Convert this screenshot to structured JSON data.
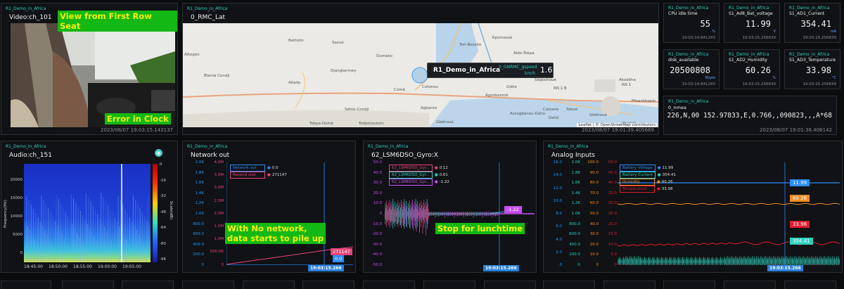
{
  "video": {
    "source": "R1_Demo_in_Africa",
    "title": "Video:ch_101",
    "label_top": "View from First Row Seat",
    "label_bottom": "Error in Clock",
    "timestamp": "2023/08/07 19:03:15.143137"
  },
  "map": {
    "source": "R1_Demo_in_Africa",
    "title": "0_RMC_Lat",
    "timestamp": "2023/08/07 19:01:39.405669",
    "attribution": "Leaflet | © OpenStreetMap contributors",
    "popup_name": "R1_Demo_in_Africa",
    "popup_field": "0_GNRMC_gspeed",
    "popup_unit": "km/h",
    "popup_value": "1.6",
    "road1": "RNIE 1",
    "road2": "RN 1",
    "places": [
      "Bathoto",
      "Sazué",
      "Oumako",
      "Tori-Bossito",
      "Attogon",
      "Djanglanmey",
      "Allada",
      "Blama Condji",
      "Séhio-Condji",
      "Cotonou",
      "Agbanto",
      "Agonkanmè",
      "Gbéhoué",
      "Ouidah",
      "Kpomassé",
      "Ségbohoué",
      "Todjonoukoin",
      "Aïdo-Tokpa",
      "Dahé",
      "Assogbénou-Daho",
      "Gléta",
      "Calvaire",
      "Gbèhoué",
      "Toboé",
      "Tokpa-Domè",
      "Akodéha",
      "Comè",
      "RN 1 B",
      "RN 1",
      "Misankbopin"
    ]
  },
  "metrics": [
    {
      "source": "R1_Demo_in_Africa",
      "title": "CPU idle time",
      "value": "55",
      "unit": "%",
      "ts": "19:03:14.841293"
    },
    {
      "source": "R1_Demo_in_Africa",
      "title": "S1_Ad8_Bat_voltage",
      "value": "11.99",
      "unit": "V",
      "ts": "19:03:15.256839"
    },
    {
      "source": "R1_Demo_in_Africa",
      "title": "S1_AD1_Current",
      "value": "354.41",
      "unit": "mA",
      "ts": "19:03:15.256839"
    },
    {
      "source": "R1_Demo_in_Africa",
      "title": "disk_available",
      "value": "20500808",
      "unit": "Kbyte",
      "ts": "19:03:14.841293"
    },
    {
      "source": "R1_Demo_in_Africa",
      "title": "S1_AD2_Humidity",
      "value": "60.26",
      "unit": "%",
      "ts": "19:03:15.256839"
    },
    {
      "source": "R1_Demo_in_Africa",
      "title": "S1_AD3_Temperature",
      "value": "33.98",
      "unit": "°C",
      "ts": "19:03:15.256839"
    }
  ],
  "nmea": {
    "source": "R1_Demo_in_Africa",
    "title": "0_nmea",
    "value": "226,N,00 152.97833,E,0.766,,090823,,,A*68",
    "timestamp": "2023/08/07 19:01:38.406142"
  },
  "audio": {
    "source": "R1_Demo_in_Africa",
    "title": "Audio:ch_151",
    "ylabel": "Frequency(Hz)",
    "cbar_label": "Scale(dB)",
    "yticks": [
      "20000",
      "15000",
      "10000",
      "5000",
      "0"
    ],
    "xticks": [
      "18:45:00",
      "18:50:00",
      "18:55:00",
      "19:00:00",
      "19:05:00"
    ],
    "cbar_ticks": [
      "0",
      "-16",
      "-32",
      "-48",
      "-64",
      "-80",
      "-96"
    ]
  },
  "network": {
    "source": "R1_Demo_in_Africa",
    "title": "Network out",
    "legend": [
      {
        "name": "Network out",
        "value": "0.0",
        "color": "#2a8cff"
      },
      {
        "name": "Resend size",
        "value": "271147",
        "color": "#e8457a"
      }
    ],
    "ylabels_left": [
      "2.0K",
      "1.8K",
      "1.6K",
      "1.4K",
      "1.2K",
      "1.0K",
      "800.0",
      "600.0",
      "400.0",
      "200.0",
      "0"
    ],
    "ylabels_right": [
      "4.0M",
      "3.5M",
      "3.0M",
      "2.5M",
      "2.0M",
      "1.5M",
      "1.0M",
      "500.0K",
      "0"
    ],
    "annotation": "With No network,\ndata starts to pile up",
    "val_pink": "271147",
    "val_blue": "0.0",
    "cursor": "19:03:15.266"
  },
  "gyro": {
    "source": "R1_Demo_in_Africa",
    "title": "62_LSM6DSO_Gyro:X",
    "legend": [
      {
        "name": "62_LSM6DSO_Gyr...",
        "value": "0.12",
        "color": "#e8457a"
      },
      {
        "name": "62_LSM6DSO_Gyr...",
        "value": "0.61",
        "color": "#2fd0bd"
      },
      {
        "name": "62_LSM6DSO_Gyr...",
        "value": "-1.22",
        "color": "#c64ff0"
      }
    ],
    "ylabels": [
      "50.0",
      "40.0",
      "30.0",
      "20.0",
      "10.0",
      "0",
      "-10.0",
      "-20.0",
      "-30.0",
      "-40.0",
      "-50.0"
    ],
    "annotation": "Stop for lunchtime",
    "last_value": "-1.22",
    "cursor": "19:03:15.266"
  },
  "analog": {
    "source": "R1_Demo_in_Africa",
    "title": "Analog Inputs",
    "legend": [
      {
        "name": "Battery Voltage",
        "value": "11.99",
        "color": "#2a8cff"
      },
      {
        "name": "Battery Current",
        "value": "354.41",
        "color": "#2fd0bd"
      },
      {
        "name": "Humidity",
        "value": "60.26",
        "color": "#f08a24"
      },
      {
        "name": "Temperature",
        "value": "33.98",
        "color": "#e01e2e"
      }
    ],
    "axis1": [
      "16.0",
      "14.0",
      "12.0",
      "10.0",
      "8.0",
      "6.0",
      "4.0",
      "2.0",
      "0"
    ],
    "axis2": [
      "2.0K",
      "1.8K",
      "1.6K",
      "1.4K",
      "1.2K",
      "1.0K",
      "800.0",
      "600.0",
      "400.0",
      "200.0",
      "0"
    ],
    "axis3": [
      "100.0",
      "90.0",
      "80.0",
      "70.0",
      "60.0",
      "50.0",
      "40.0",
      "30.0",
      "20.0",
      "10.0",
      "0"
    ],
    "axis4": [
      "50.0",
      "45.0",
      "40.0",
      "35.0",
      "30.0",
      "25.0",
      "20.0",
      "15.0",
      "10.0",
      "5.0",
      "0"
    ],
    "val_blue": "11.99",
    "val_orange": "60.26",
    "val_red": "33.98",
    "val_teal": "354.41",
    "cursor": "19:03:15.266"
  },
  "colors": {
    "teal": "#2fd0bd",
    "blue": "#2a8cff",
    "pink": "#e8457a",
    "green_label": "#14b814",
    "yellow_text": "#f4f200"
  }
}
